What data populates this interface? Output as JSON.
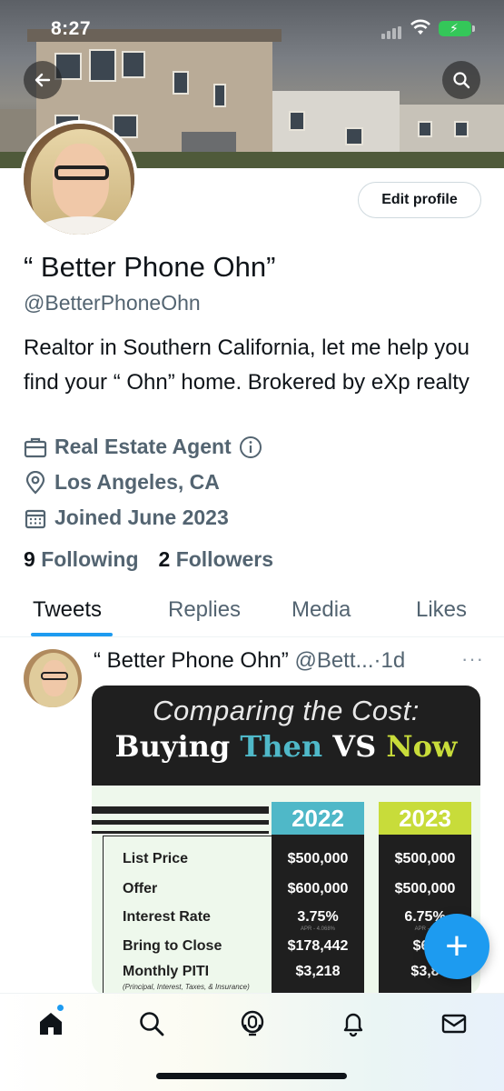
{
  "status_bar": {
    "time": "8:27"
  },
  "profile": {
    "edit_label": "Edit profile",
    "name": "“ Better Phone Ohn”",
    "handle": "@BetterPhoneOhn",
    "bio": "Realtor in Southern California, let me help you find your “ Ohn” home. Brokered by eXp realty",
    "category": "Real Estate Agent",
    "location": "Los Angeles, CA",
    "joined": "Joined June 2023",
    "following_count": "9",
    "following_label": "Following",
    "followers_count": "2",
    "followers_label": "Followers"
  },
  "tabs": [
    {
      "label": "Tweets",
      "active": true
    },
    {
      "label": "Replies"
    },
    {
      "label": "Media"
    },
    {
      "label": "Likes"
    }
  ],
  "tweet": {
    "name": "“ Better Phone Ohn”",
    "handle": "@Bett...",
    "time": "·1d",
    "more": "···",
    "image": {
      "title": "Comparing the Cost:",
      "headline_a": "Buying ",
      "headline_then": "Then",
      "headline_vs": " VS ",
      "headline_now": "Now",
      "col1": "2022",
      "col2": "2023",
      "rows": [
        {
          "label": "List Price",
          "v1": "$500,000",
          "v2": "$500,000"
        },
        {
          "label": "Offer",
          "v1": "$600,000",
          "v2": "$500,000"
        },
        {
          "label": "Interest Rate",
          "v1": "3.75%",
          "v2": "6.75%"
        },
        {
          "label": "Bring to Close",
          "v1": "$178,442",
          "v2": "$66"
        },
        {
          "label": "Monthly PITI",
          "v1": "$3,218",
          "v2": "$3,8"
        }
      ],
      "apr1": "APR - 4.068%",
      "apr2": "APR - 7.",
      "footnote": "(Principal, Interest, Taxes, & Insurance)"
    }
  },
  "fab_label": "+",
  "colors": {
    "accent": "#1d9bf0",
    "then": "#4fb8c8",
    "now": "#c8dc3a"
  }
}
